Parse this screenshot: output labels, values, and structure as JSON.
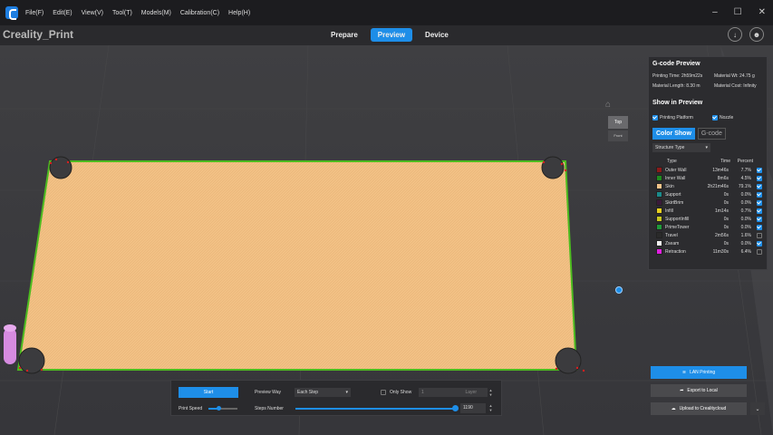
{
  "menu": [
    "File(F)",
    "Edit(E)",
    "View(V)",
    "Tool(T)",
    "Models(M)",
    "Calibration(C)",
    "Help(H)"
  ],
  "window_controls": [
    "–",
    "☐",
    "✕"
  ],
  "app_name": "Creality_Print",
  "mode_tabs": [
    {
      "label": "Prepare",
      "active": false
    },
    {
      "label": "Preview",
      "active": true
    },
    {
      "label": "Device",
      "active": false
    }
  ],
  "top_icons": [
    "download-icon",
    "user-icon"
  ],
  "view_cube": {
    "top": "Top",
    "front": "Front"
  },
  "gcode_preview": {
    "title": "G-code Preview",
    "printing_time": "Printing Time: 2h59m22s",
    "material_wt": "Material Wt: 24.75 g",
    "material_length": "Material Length: 8.30 m",
    "material_cost": "Material Cost: Infinity"
  },
  "show_in_preview": {
    "title": "Show in Preview",
    "printing_platform": "Printing Platform",
    "nozzle": "Nozzle"
  },
  "color_tabs": [
    {
      "label": "Color Show",
      "active": true
    },
    {
      "label": "G-code",
      "active": false
    }
  ],
  "structure_select": "Structure Type",
  "type_table": {
    "headers": {
      "type": "Type",
      "time": "Time",
      "percent": "Percent"
    },
    "rows": [
      {
        "name": "Outer Wall",
        "time": "13m46s",
        "pct": "7.7%",
        "color": "#8b1a1a",
        "checked": true
      },
      {
        "name": "Inner Wall",
        "time": "8m6s",
        "pct": "4.5%",
        "color": "#1e8b1e",
        "checked": true
      },
      {
        "name": "Skin",
        "time": "2h21m46s",
        "pct": "79.1%",
        "color": "#f3c48a",
        "checked": true
      },
      {
        "name": "Support",
        "time": "0s",
        "pct": "0.0%",
        "color": "#1a8b8b",
        "checked": true
      },
      {
        "name": "SkirtBrim",
        "time": "0s",
        "pct": "0.0%",
        "color": "#3a1a3a",
        "checked": true
      },
      {
        "name": "Infill",
        "time": "1m14s",
        "pct": "0.7%",
        "color": "#e8d020",
        "checked": true
      },
      {
        "name": "SupportInfill",
        "time": "0s",
        "pct": "0.0%",
        "color": "#c8c820",
        "checked": true
      },
      {
        "name": "PrimeTower",
        "time": "0s",
        "pct": "0.0%",
        "color": "#1e9a3a",
        "checked": true
      },
      {
        "name": "Travel",
        "time": "2m56s",
        "pct": "1.6%",
        "color": "#2a2a2a",
        "checked": false
      },
      {
        "name": "Zseam",
        "time": "0s",
        "pct": "0.0%",
        "color": "#f0f0f0",
        "checked": true
      },
      {
        "name": "Retraction",
        "time": "11m30s",
        "pct": "6.4%",
        "color": "#e020e0",
        "checked": false
      }
    ]
  },
  "actions": {
    "lan_printing": "LAN Printing",
    "export_local": "Export to Local",
    "upload_cloud": "Upload to Crealitycloud"
  },
  "playback": {
    "start": "Start",
    "print_speed_label": "Print Speed",
    "print_speed_fraction": 0.35,
    "preview_way_label": "Preview Way",
    "preview_way_value": "Each Step",
    "only_show_label": "Only Show",
    "only_show_value": "1",
    "layer_placeholder": "Layer",
    "steps_label": "Steps Number",
    "steps_value": "1190",
    "steps_fraction": 1.0
  },
  "colors": {
    "accent": "#1e8ee8",
    "bed": "#f2c185",
    "bed_edge": "#4cbb1f"
  }
}
